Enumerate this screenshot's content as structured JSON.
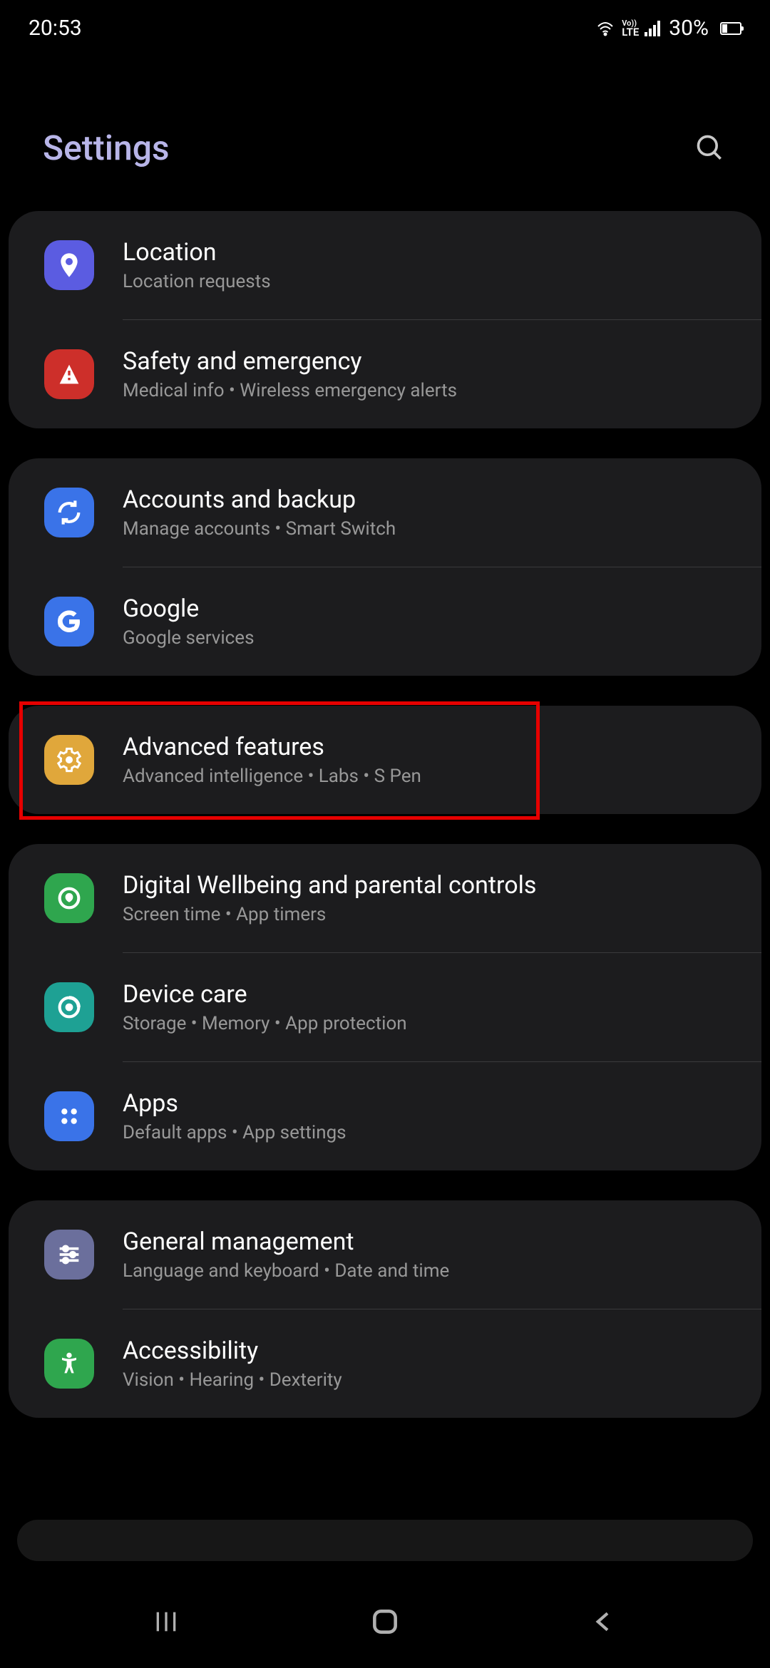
{
  "status": {
    "time": "20:53",
    "battery_text": "30%",
    "volte_label": "VoLTE"
  },
  "header": {
    "title": "Settings"
  },
  "groups": [
    {
      "items": [
        {
          "icon": "location",
          "color": "#5B5CE1",
          "title": "Location",
          "subtitle": "Location requests",
          "highlighted": false
        },
        {
          "icon": "emergency",
          "color": "#CD2F2A",
          "title": "Safety and emergency",
          "subtitle": "Medical info  •  Wireless emergency alerts",
          "highlighted": false
        }
      ]
    },
    {
      "items": [
        {
          "icon": "sync",
          "color": "#3A73E8",
          "title": "Accounts and backup",
          "subtitle": "Manage accounts  •  Smart Switch",
          "highlighted": false
        },
        {
          "icon": "google",
          "color": "#3A73E8",
          "title": "Google",
          "subtitle": "Google services",
          "highlighted": false
        }
      ]
    },
    {
      "items": [
        {
          "icon": "advanced",
          "color": "#E0A73B",
          "title": "Advanced features",
          "subtitle": "Advanced intelligence  •  Labs  •  S Pen",
          "highlighted": true
        }
      ]
    },
    {
      "items": [
        {
          "icon": "wellbeing",
          "color": "#2FA64E",
          "title": "Digital Wellbeing and parental controls",
          "subtitle": "Screen time  •  App timers",
          "highlighted": false
        },
        {
          "icon": "care",
          "color": "#1EA194",
          "title": "Device care",
          "subtitle": "Storage  •  Memory  •  App protection",
          "highlighted": false
        },
        {
          "icon": "apps",
          "color": "#3A73E8",
          "title": "Apps",
          "subtitle": "Default apps  •  App settings",
          "highlighted": false
        }
      ]
    },
    {
      "items": [
        {
          "icon": "general",
          "color": "#6B6F9C",
          "title": "General management",
          "subtitle": "Language and keyboard  •  Date and time",
          "highlighted": false
        },
        {
          "icon": "accessibility",
          "color": "#2FA64E",
          "title": "Accessibility",
          "subtitle": "Vision  •  Hearing  •  Dexterity",
          "highlighted": false
        }
      ]
    }
  ]
}
